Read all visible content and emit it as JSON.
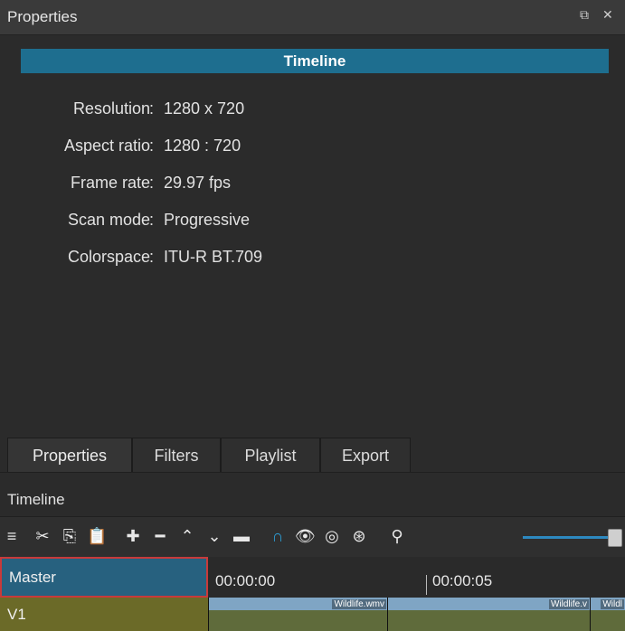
{
  "window": {
    "title": "Properties"
  },
  "header": {
    "title": "Timeline"
  },
  "properties": [
    {
      "label": "Resolution",
      "value": "1280 x 720"
    },
    {
      "label": "Aspect ratio",
      "value": "1280 : 720"
    },
    {
      "label": "Frame rate",
      "value": "29.97 fps"
    },
    {
      "label": "Scan mode",
      "value": "Progressive"
    },
    {
      "label": "Colorspace",
      "value": "ITU-R BT.709"
    }
  ],
  "separator": ":",
  "tabs": [
    {
      "label": "Properties",
      "active": true
    },
    {
      "label": "Filters",
      "active": false
    },
    {
      "label": "Playlist",
      "active": false
    },
    {
      "label": "Export",
      "active": false
    }
  ],
  "timeline": {
    "label": "Timeline",
    "zoom": 1.0,
    "tracks": [
      "Master",
      "V1"
    ],
    "timecodes": [
      "00:00:00",
      "00:00:05"
    ],
    "clips": [
      "Wildlife.wmv",
      "Wildlife.v",
      "Wildl"
    ]
  },
  "colors": {
    "accent": "#1e6e8f",
    "master_border": "#c83a3a",
    "v1": "#6b6a28"
  }
}
